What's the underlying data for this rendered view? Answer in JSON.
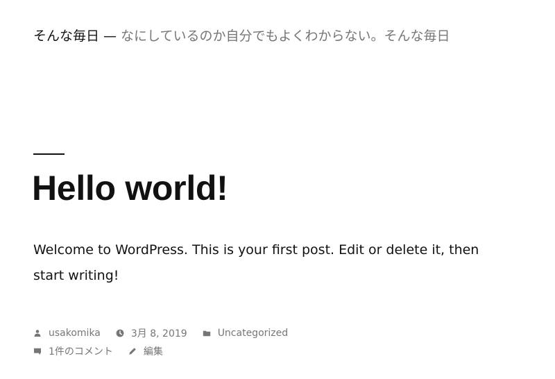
{
  "header": {
    "site_title": "そんな毎日",
    "separator": "—",
    "site_description": "なにしているのか自分でもよくわからない。そんな毎日"
  },
  "post": {
    "title": "Hello world!",
    "content": "Welcome to WordPress. This is your first post. Edit or delete it, then start writing!",
    "meta": {
      "author": "usakomika",
      "date": "3月 8, 2019",
      "category": "Uncategorized",
      "comments": "1件のコメント",
      "edit": "編集"
    }
  },
  "icons": {
    "author": "person-icon",
    "date": "clock-icon",
    "category": "folder-icon",
    "comments": "comment-icon",
    "edit": "pencil-icon"
  },
  "colors": {
    "text": "#111111",
    "muted": "#767676",
    "background": "#ffffff"
  }
}
